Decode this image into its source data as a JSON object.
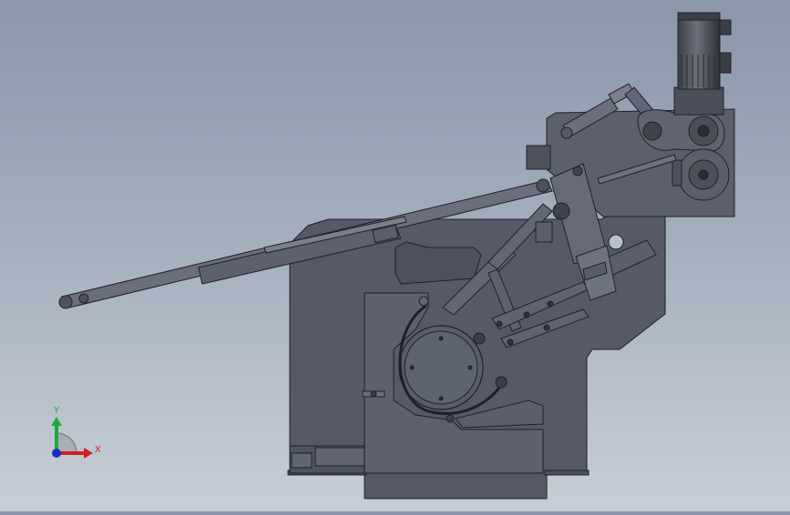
{
  "triad": {
    "y_label": "Y",
    "x_label": "X",
    "y_color": "#1fa83a",
    "x_color": "#d42020",
    "z_color": "#1a2fbf"
  },
  "colors": {
    "background_top": "#8a97aa",
    "background_bottom": "#c7ced7",
    "body_fill": "#555a66",
    "body_fill_dark": "#4a4f5a",
    "edge": "#1e2128",
    "plate_fill": "#616673",
    "arm_fill": "#6a6f7b"
  },
  "parts": {
    "motor": "gear-motor",
    "roller": "large-roller",
    "conveyor": "inclined-conveyor-arm",
    "cylinder": "pneumatic-cylinder",
    "hole": "mounting-hole"
  }
}
